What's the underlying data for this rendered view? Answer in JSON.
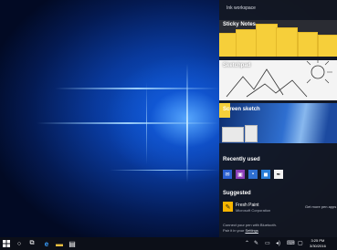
{
  "ink_workspace": {
    "title": "Ink workspace",
    "sticky_notes": {
      "label": "Sticky Notes"
    },
    "sketchpad": {
      "label": "Sketchpad"
    },
    "screen_sketch": {
      "label": "Screen sketch"
    },
    "recently_used": {
      "label": "Recently used",
      "apps": [
        {
          "icon": "mail-icon",
          "color": "#2a5fcf"
        },
        {
          "icon": "photos-icon",
          "color": "#8b3fb8"
        },
        {
          "icon": "onenote-icon",
          "color": "#2f6fd0"
        },
        {
          "icon": "store-icon",
          "color": "#2a7fd8"
        },
        {
          "icon": "pen-icon",
          "color": "#f2f2f2"
        }
      ]
    },
    "suggested": {
      "label": "Suggested",
      "app_name": "Fresh Paint",
      "publisher": "Microsoft Corporation",
      "get_more": "Get more pen apps"
    },
    "connect_line1": "Connect your pen with Bluetooth.",
    "connect_line2_prefix": "Pair it in your ",
    "connect_link": "Settings"
  },
  "taskbar": {
    "time": "3:25 PM",
    "date": "3/30/2016",
    "icons": [
      "windows-icon",
      "cortana-icon",
      "task-view-icon",
      "edge-icon",
      "file-explorer-icon",
      "store-icon"
    ],
    "tray": [
      "chevron-up-icon",
      "pen-workspace-icon",
      "network-icon",
      "volume-icon",
      "keyboard-icon",
      "action-center-icon"
    ]
  },
  "colors": {
    "panel": "#141822",
    "sticky": "#f6cf3a",
    "accent": "#1c6fe0"
  }
}
